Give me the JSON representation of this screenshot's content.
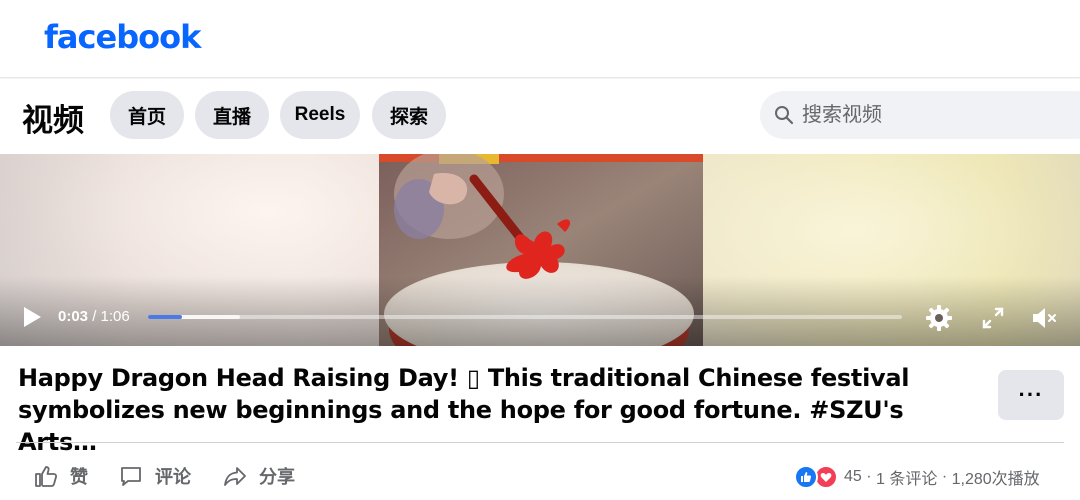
{
  "header": {
    "logo_text": "facebook",
    "logo_color": "#0866ff"
  },
  "nav": {
    "title": "视频",
    "tabs": [
      {
        "label": "首页"
      },
      {
        "label": "直播"
      },
      {
        "label": "Reels"
      },
      {
        "label": "探索"
      }
    ],
    "search_placeholder": "搜索视频",
    "search_icon": "search-icon"
  },
  "player": {
    "current_time": "0:03",
    "separator": " / ",
    "duration": "1:06",
    "progress_fraction": 0.045,
    "buffered_fraction": 0.122,
    "progress_color": "#4a7ae6",
    "icons": [
      "play-icon",
      "gear-icon",
      "fullscreen-icon",
      "volume-muted-icon"
    ]
  },
  "post": {
    "title": "Happy Dragon Head Raising Day! ▯ This traditional Chinese festival symbolizes new beginnings and the hope for good fortune. #SZU's Arts…",
    "more_label": "···"
  },
  "actions": [
    {
      "label": "赞",
      "icon": "thumbs-up-icon"
    },
    {
      "label": "评论",
      "icon": "comment-icon"
    },
    {
      "label": "分享",
      "icon": "share-icon"
    }
  ],
  "stats": {
    "reaction_count": "45",
    "comments": "1 条评论",
    "views": "1,280次播放",
    "dot": " · ",
    "reactions": [
      "like-reaction-icon",
      "love-reaction-icon"
    ],
    "like_color": "#1877f2",
    "love_color": "#f33e58"
  }
}
